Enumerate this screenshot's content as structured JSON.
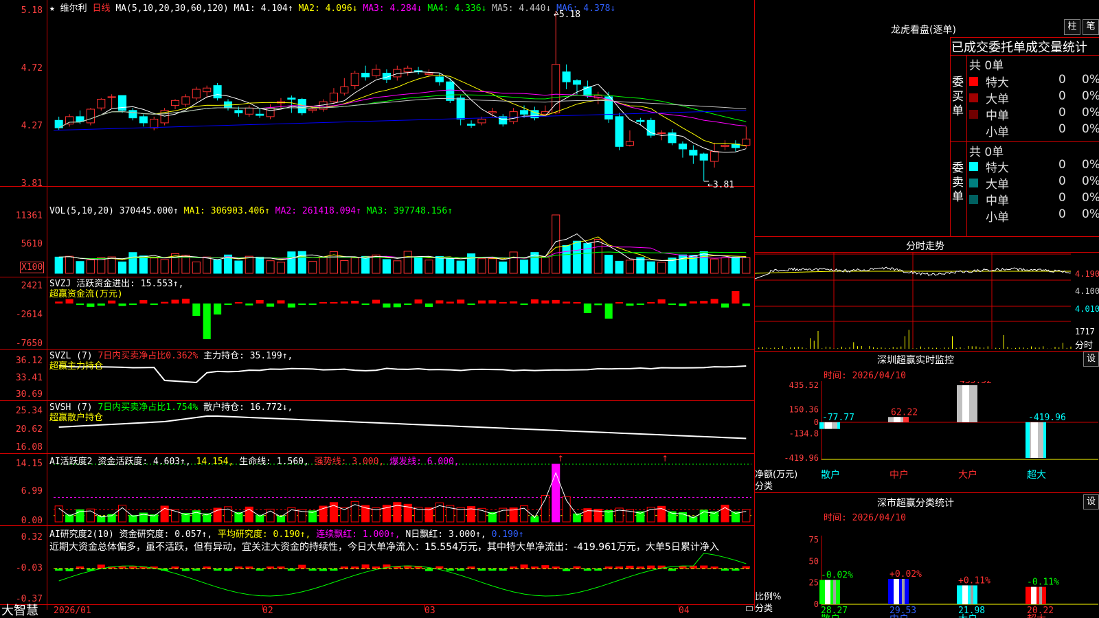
{
  "app": {
    "brand": "大智慧"
  },
  "colors": {
    "up": "#ff3030",
    "down": "#00ffff",
    "grid": "#d00000",
    "ma1": "#ffffff",
    "ma2": "#ffff00",
    "ma3": "#ff00ff",
    "ma4": "#00ff00",
    "ma5": "#c0c0c0",
    "ma6": "#0000ff"
  },
  "kline": {
    "star_icon": "star-icon",
    "stock_name": "维尔利",
    "period": "日线",
    "ma_label": "MA(5,10,20,30,60,120)",
    "ma1": "MA1: 4.104↑",
    "ma2": "MA2: 4.096↓",
    "ma3": "MA3: 4.284↓",
    "ma4": "MA4: 4.336↓",
    "ma5": "MA5: 4.440↓",
    "ma6": "MA6: 4.378↓",
    "y_ticks": [
      "5.18",
      "4.72",
      "4.27",
      "3.81"
    ],
    "high_label": "5.18",
    "low_label": "3.81",
    "candles": [
      [
        4.3,
        4.24,
        4.33,
        4.22
      ],
      [
        4.27,
        4.33,
        4.35,
        4.25
      ],
      [
        4.33,
        4.29,
        4.38,
        4.27
      ],
      [
        4.28,
        4.39,
        4.4,
        4.26
      ],
      [
        4.4,
        4.47,
        4.48,
        4.38
      ],
      [
        4.49,
        4.49,
        4.51,
        4.4
      ],
      [
        4.5,
        4.38,
        4.5,
        4.36
      ],
      [
        4.38,
        4.32,
        4.4,
        4.3
      ],
      [
        4.33,
        4.28,
        4.35,
        4.25
      ],
      [
        4.24,
        4.31,
        4.33,
        4.22
      ],
      [
        4.28,
        4.38,
        4.4,
        4.26
      ],
      [
        4.42,
        4.46,
        4.47,
        4.39
      ],
      [
        4.43,
        4.49,
        4.51,
        4.41
      ],
      [
        4.48,
        4.55,
        4.57,
        4.46
      ],
      [
        4.53,
        4.56,
        4.58,
        4.48
      ],
      [
        4.58,
        4.48,
        4.6,
        4.46
      ],
      [
        4.45,
        4.4,
        4.47,
        4.38
      ],
      [
        4.38,
        4.36,
        4.41,
        4.33
      ],
      [
        4.35,
        4.4,
        4.42,
        4.33
      ],
      [
        4.35,
        4.34,
        4.4,
        4.32
      ],
      [
        4.33,
        4.4,
        4.43,
        4.31
      ],
      [
        4.44,
        4.45,
        4.48,
        4.4
      ],
      [
        4.48,
        4.47,
        4.5,
        4.36
      ],
      [
        4.47,
        4.36,
        4.48,
        4.34
      ],
      [
        4.38,
        4.39,
        4.41,
        4.36
      ],
      [
        4.39,
        4.45,
        4.47,
        4.37
      ],
      [
        4.45,
        4.52,
        4.56,
        4.43
      ],
      [
        4.52,
        4.57,
        4.64,
        4.5
      ],
      [
        4.58,
        4.68,
        4.7,
        4.55
      ],
      [
        4.68,
        4.65,
        4.74,
        4.62
      ],
      [
        4.66,
        4.71,
        4.75,
        4.64
      ],
      [
        4.68,
        4.63,
        4.71,
        4.6
      ],
      [
        4.65,
        4.71,
        4.74,
        4.62
      ],
      [
        4.69,
        4.72,
        4.74,
        4.66
      ],
      [
        4.7,
        4.69,
        4.73,
        4.67
      ],
      [
        4.67,
        4.68,
        4.71,
        4.65
      ],
      [
        4.65,
        4.61,
        4.68,
        4.58
      ],
      [
        4.61,
        4.46,
        4.64,
        4.44
      ],
      [
        4.48,
        4.31,
        4.5,
        4.26
      ],
      [
        4.27,
        4.26,
        4.3,
        4.24
      ],
      [
        4.28,
        4.31,
        4.33,
        4.26
      ],
      [
        4.36,
        4.37,
        4.4,
        4.33
      ],
      [
        4.33,
        4.27,
        4.35,
        4.25
      ],
      [
        4.29,
        4.37,
        4.4,
        4.27
      ],
      [
        4.38,
        4.35,
        4.42,
        4.32
      ],
      [
        4.38,
        4.32,
        4.41,
        4.3
      ],
      [
        4.35,
        4.37,
        4.42,
        4.33
      ],
      [
        4.36,
        4.75,
        5.18,
        4.35
      ],
      [
        4.69,
        4.61,
        4.75,
        4.55
      ],
      [
        4.62,
        4.59,
        4.63,
        4.51
      ],
      [
        4.57,
        4.5,
        4.62,
        4.48
      ],
      [
        4.48,
        4.5,
        4.53,
        4.43
      ],
      [
        4.49,
        4.31,
        4.53,
        4.28
      ],
      [
        4.33,
        4.09,
        4.36,
        4.06
      ],
      [
        4.1,
        4.13,
        4.22,
        4.09
      ],
      [
        4.3,
        4.29,
        4.32,
        4.26
      ],
      [
        4.3,
        4.18,
        4.32,
        4.16
      ],
      [
        4.2,
        4.2,
        4.22,
        4.14
      ],
      [
        4.2,
        4.12,
        4.23,
        4.1
      ],
      [
        4.11,
        4.07,
        4.13,
        4.0
      ],
      [
        4.06,
        4.02,
        4.1,
        3.95
      ],
      [
        4.03,
        3.98,
        4.04,
        3.81
      ],
      [
        3.97,
        4.05,
        4.12,
        3.92
      ],
      [
        4.09,
        4.1,
        4.14,
        4.06
      ],
      [
        4.11,
        4.08,
        4.14,
        4.05
      ],
      [
        4.1,
        4.15,
        4.25,
        4.08
      ]
    ]
  },
  "vol": {
    "title": "VOL(5,10,20)",
    "value": "370445.000↑",
    "ma1": "MA1: 306903.406↑",
    "ma2": "MA2: 261418.094↑",
    "ma3": "MA3: 397748.156↑",
    "y_ticks": [
      "11361",
      "5610"
    ],
    "unit": "X100"
  },
  "svzj": {
    "title": "SVZJ",
    "label": "活跃资金进出: 15.553↑,",
    "subtitle": "超赢资金流(万元)",
    "y_ticks": [
      "2421",
      "-2614",
      "-7650"
    ]
  },
  "svzl": {
    "title": "SVZL (7)",
    "ratio": "7日内买卖净占比0.362%",
    "label": "主力持仓: 35.199↑,",
    "subtitle": "超赢主力持仓",
    "y_ticks": [
      "36.12",
      "33.41",
      "30.69"
    ]
  },
  "svsh": {
    "title": "SVSH (7)",
    "ratio": "7日内买卖净占比1.754%",
    "label": "散户持仓: 16.772↓,",
    "subtitle": "超赢散户持仓",
    "y_ticks": [
      "25.34",
      "20.62",
      "16.08"
    ]
  },
  "ai_active": {
    "title": "AI活跃度2",
    "label1": "资金活跃度: 4.603↑,",
    "label2": "14.154,",
    "label3": "生命线: 1.560,",
    "label4": "强势线: 3.000,",
    "label5": "爆发线: 6.000,",
    "y_ticks": [
      "14.15",
      "6.99",
      "0.00"
    ]
  },
  "ai_research": {
    "title": "AI研究度2(10)",
    "label1": "资金研究度: 0.057↑,",
    "label2": "平均研究度: 0.190↑,",
    "label3": "连续飘红: 1.000↑,",
    "label4": "N日飘红: 3.000↑,",
    "label5": "0.190↑",
    "comment": "近期大资金总体偏多，虽不活跃，但有异动，宜关注大资金的持续性，今日大单净流入：15.554万元，其中特大单净流出：-419.961万元，大单5日累计净入",
    "y_ticks": [
      "0.32",
      "-0.03",
      "-0.37"
    ]
  },
  "x_axis": {
    "labels": [
      "2026/01",
      "02",
      "03",
      "04"
    ]
  },
  "right": {
    "dragon_title": "龙虎看盘(逐单)",
    "btn_bar": "柱",
    "btn_pen": "笔",
    "stats_title": "已成交委托单成交量统计",
    "buy_side": "委买单",
    "sell_side": "委卖单",
    "buy_total": "共 0单",
    "sell_total": "共 0单",
    "buy_rows": [
      {
        "name": "特大",
        "count": "0",
        "pct": "0%"
      },
      {
        "name": "大单",
        "count": "0",
        "pct": "0%"
      },
      {
        "name": "中单",
        "count": "0",
        "pct": "0%"
      },
      {
        "name": "小单",
        "count": "0",
        "pct": "0%"
      }
    ],
    "sell_rows": [
      {
        "name": "特大",
        "count": "0",
        "pct": "0%"
      },
      {
        "name": "大单",
        "count": "0",
        "pct": "0%"
      },
      {
        "name": "中单",
        "count": "0",
        "pct": "0%"
      },
      {
        "name": "小单",
        "count": "0",
        "pct": "0%"
      }
    ],
    "intraday_title": "分时走势",
    "intraday_prices": [
      "4.190",
      "4.100",
      "4.010"
    ],
    "intraday_vol": "1717",
    "intraday_vol_label": "分时",
    "monitor_title": "深圳超赢实时监控",
    "monitor_btn": "设",
    "monitor_time": "时间: 2026/04/10",
    "monitor_y_ticks": [
      "435.52",
      "150.36",
      "0",
      "-134.8",
      "-419.96"
    ],
    "monitor_ylabel": "净额(万元)",
    "monitor_xlabel": "分类",
    "monitor_categories": [
      "散户",
      "中户",
      "大户",
      "超大"
    ],
    "monitor_values": [
      -77.77,
      62.22,
      435.52,
      -419.96
    ],
    "monitor_value_labels": [
      "-77.77",
      "62.22",
      "435.52",
      "-419.96"
    ],
    "class_title": "深市超赢分类统计",
    "class_btn": "设",
    "class_time": "时间: 2026/04/10",
    "class_y_ticks": [
      "75",
      "50",
      "25",
      "0"
    ],
    "class_ylabel": "比例%",
    "class_xlabel": "分类",
    "class_categories": [
      "散户",
      "中户",
      "大户",
      "超大"
    ],
    "class_values": [
      28.27,
      29.53,
      21.98,
      20.22
    ],
    "class_value_labels": [
      "28.27",
      "29.53",
      "21.98",
      "20.22"
    ],
    "class_changes": [
      "-0.02%",
      "+0.02%",
      "+0.11%",
      "-0.11%"
    ]
  },
  "chart_data": [
    {
      "type": "bar",
      "title": "深圳超赢实时监控",
      "ylabel": "净额(万元)",
      "xlabel": "分类",
      "categories": [
        "散户",
        "中户",
        "大户",
        "超大"
      ],
      "values": [
        -77.77,
        62.22,
        435.52,
        -419.96
      ],
      "ylim": [
        -419.96,
        435.52
      ]
    },
    {
      "type": "bar",
      "title": "深市超赢分类统计",
      "ylabel": "比例%",
      "xlabel": "分类",
      "categories": [
        "散户",
        "中户",
        "大户",
        "超大"
      ],
      "values": [
        28.27,
        29.53,
        21.98,
        20.22
      ],
      "ylim": [
        0,
        75
      ]
    }
  ]
}
